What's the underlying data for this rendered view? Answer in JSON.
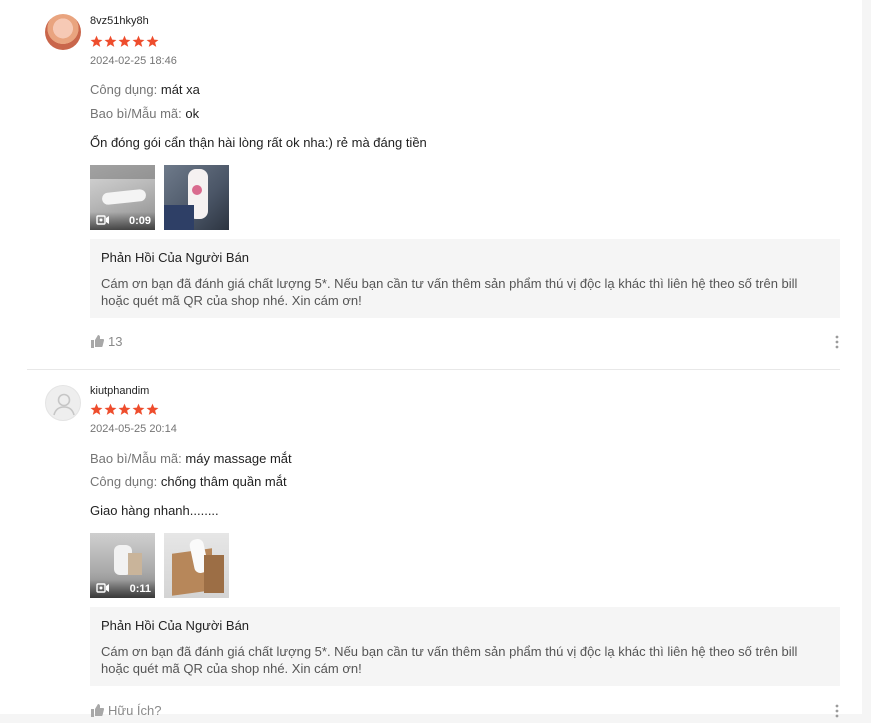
{
  "reviews": [
    {
      "username": "8vz51hky8h",
      "rating": 5,
      "date": "2024-02-25 18:46",
      "attributes": [
        {
          "label": "Công dụng:",
          "value": "mát xa"
        },
        {
          "label": "Bao bì/Mẫu mã:",
          "value": "ok"
        }
      ],
      "comment": "Ổn đóng gói cẩn thận hài lòng rất ok nha:) rẻ mà đáng tiền",
      "media": [
        {
          "type": "video",
          "duration": "0:09"
        },
        {
          "type": "image"
        }
      ],
      "seller_reply": {
        "title": "Phản Hồi Của Người Bán",
        "text": "Cám ơn bạn đã đánh giá chất lượng 5*. Nếu bạn cần tư vấn thêm sản phẩm thú vị độc lạ khác thì liên hệ theo số trên bill hoặc quét mã QR của shop nhé. Xin cám ơn!"
      },
      "likes": "13"
    },
    {
      "username": "kiutphandim",
      "rating": 5,
      "date": "2024-05-25 20:14",
      "attributes": [
        {
          "label": "Bao bì/Mẫu mã:",
          "value": "máy massage mắt"
        },
        {
          "label": "Công dụng:",
          "value": "chống thâm quần mắt"
        }
      ],
      "comment": "Giao hàng nhanh........",
      "media": [
        {
          "type": "video",
          "duration": "0:11"
        },
        {
          "type": "image"
        }
      ],
      "seller_reply": {
        "title": "Phản Hồi Của Người Bán",
        "text": "Cám ơn bạn đã đánh giá chất lượng 5*. Nếu bạn cần tư vấn thêm sản phẩm thú vị độc lạ khác thì liên hệ theo số trên bill hoặc quét mã QR của shop nhé. Xin cám ơn!"
      },
      "likes": "Hữu Ích?"
    }
  ],
  "colors": {
    "star": "#ee4d2d",
    "muted": "#757575",
    "reply_bg": "#f5f5f5"
  }
}
